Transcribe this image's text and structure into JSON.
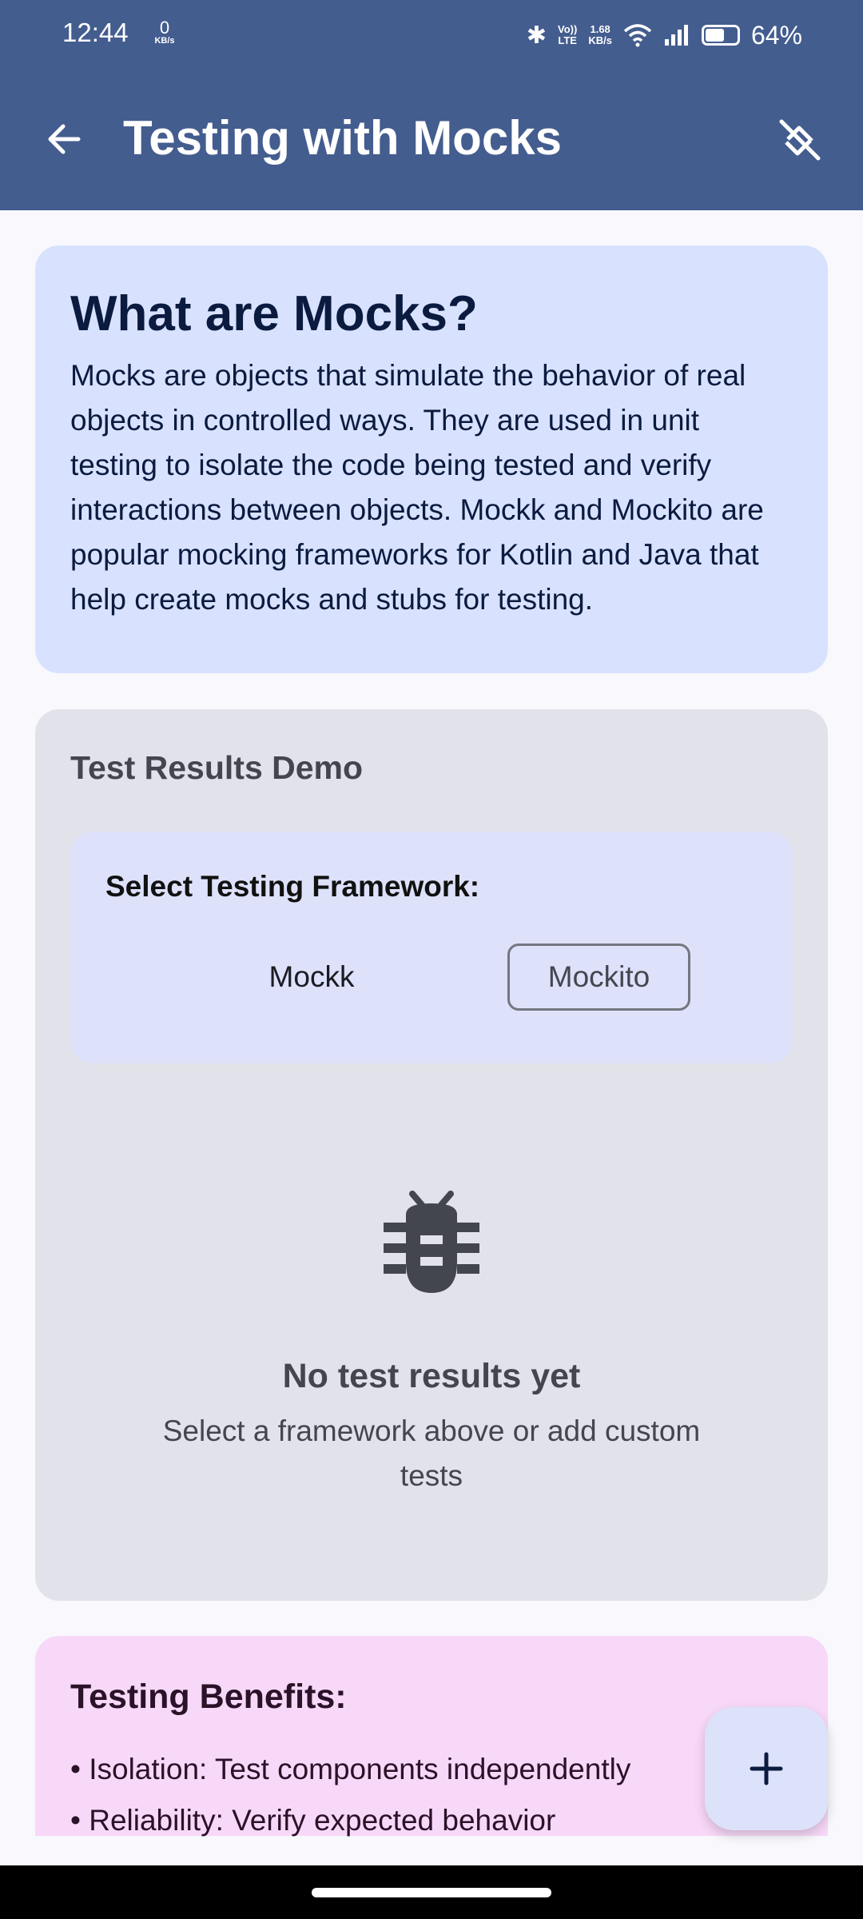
{
  "status": {
    "time": "12:44",
    "net_speed": "0",
    "net_unit": "KB/s",
    "volte_top": "Vo))",
    "volte_bottom": "LTE",
    "speed2_value": "1.68",
    "speed2_unit": "KB/s",
    "battery_pct": "64%",
    "battery_level": 0.64
  },
  "app_bar": {
    "title": "Testing with Mocks",
    "back_icon": "arrow-left-icon",
    "action_icon": "no-bug-icon"
  },
  "intro": {
    "heading": "What are Mocks?",
    "body": "Mocks are objects that simulate the behavior of real objects in controlled ways. They are used in unit testing to isolate the code being tested and verify interactions between objects. Mockk and Mockito are popular mocking frameworks for Kotlin and Java that help create mocks and stubs for testing."
  },
  "demo": {
    "title": "Test Results Demo",
    "framework_label": "Select Testing Framework:",
    "frameworks": [
      "Mockk",
      "Mockito"
    ],
    "empty_title": "No test results yet",
    "empty_subtitle": "Select a framework above or add custom tests"
  },
  "benefits": {
    "title": "Testing Benefits:",
    "items": [
      "• Isolation: Test components independently",
      "• Reliability: Verify expected behavior"
    ]
  },
  "fab": {
    "icon": "plus-icon"
  },
  "colors": {
    "primary": "#445d8f",
    "intro_card": "#d8e2ff",
    "demo_card": "#e2e2ea",
    "framework_box": "#dde1fa",
    "benefits_card": "#f8d8f8"
  }
}
